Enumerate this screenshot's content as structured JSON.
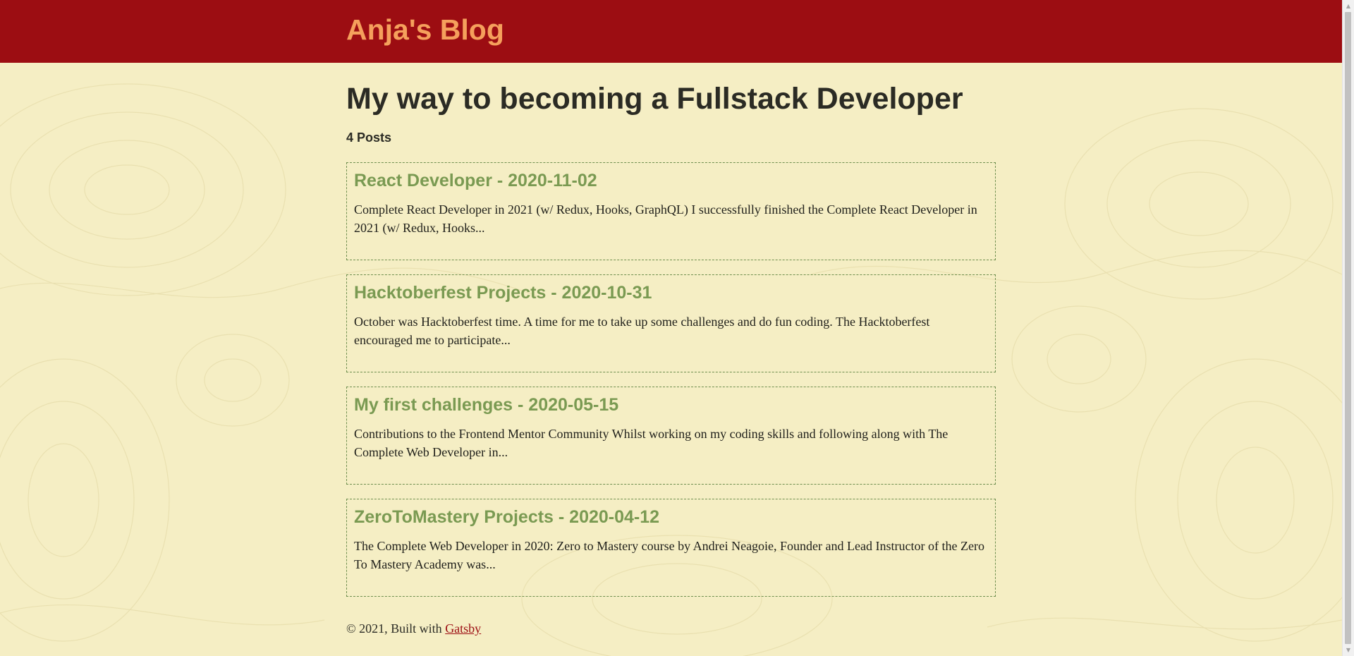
{
  "header": {
    "site_title": "Anja's Blog"
  },
  "main": {
    "page_title": "My way to becoming a Fullstack Developer",
    "post_count": "4 Posts",
    "posts": [
      {
        "title": "React Developer - 2020-11-02",
        "excerpt": "Complete React Developer in 2021 (w/ Redux, Hooks, GraphQL) I successfully finished the Complete React Developer in 2021 (w/ Redux, Hooks..."
      },
      {
        "title": "Hacktoberfest Projects - 2020-10-31",
        "excerpt": "October was Hacktoberfest time. A time for me to take up some challenges and do fun coding. The Hacktoberfest encouraged me to participate..."
      },
      {
        "title": "My first challenges - 2020-05-15",
        "excerpt": "Contributions to the Frontend Mentor Community Whilst working on my coding skills and following along with The Complete Web Developer in..."
      },
      {
        "title": "ZeroToMastery Projects - 2020-04-12",
        "excerpt": "The Complete Web Developer in 2020: Zero to Mastery course by Andrei Neagoie, Founder and Lead Instructor of the Zero To Mastery Academy was..."
      }
    ]
  },
  "footer": {
    "prefix": "© 2021, Built with",
    "link_label": "Gatsby"
  },
  "colors": {
    "header_bg": "#9c0d12",
    "site_title": "#f5a05c",
    "page_bg": "#f5eec4",
    "post_title": "#7a9a52",
    "card_border": "#6f8f4f",
    "link": "#9c0d12"
  },
  "icons": {
    "scroll_up": "scroll-up-arrow-icon",
    "scroll_down": "scroll-down-arrow-icon"
  }
}
